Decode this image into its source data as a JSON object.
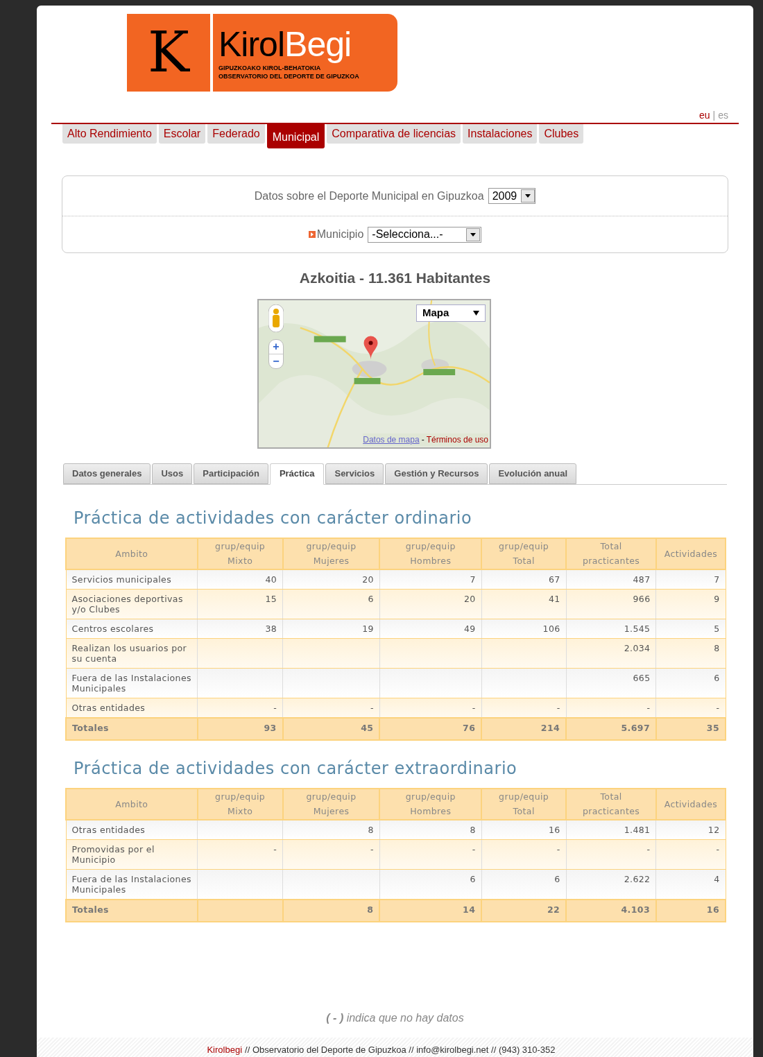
{
  "logo": {
    "letter": "K",
    "name_dark": "Kirol",
    "name_light": "Begi",
    "line_1": "GIPUZKOAKO KIROL-BEHATOKIA",
    "line_2": "OBSERVATORIO DEL DEPORTE DE GIPUZKOA"
  },
  "languages": [
    {
      "label": "eu",
      "selected": true
    },
    {
      "label": "es",
      "selected": false
    }
  ],
  "language_separator": "|",
  "nav_tabs": [
    {
      "label": "Alto Rendimiento",
      "selected": false
    },
    {
      "label": "Escolar",
      "selected": false
    },
    {
      "label": "Federado",
      "selected": false
    },
    {
      "label": "Municipal",
      "selected": true
    },
    {
      "label": "Comparativa de licencias",
      "selected": false
    },
    {
      "label": "Instalaciones",
      "selected": false
    },
    {
      "label": "Clubes",
      "selected": false
    }
  ],
  "filter": {
    "year_label": "Datos sobre el Deporte Municipal en Gipuzkoa",
    "year_value": "2009",
    "municipio_label": "Municipio",
    "municipio_value": "-Selecciona...-"
  },
  "heading": "Azkoitia - 11.361 Habitantes",
  "map": {
    "type_select": "Mapa",
    "zoom_in": "+",
    "zoom_out": "−",
    "data_link": "Datos de mapa",
    "separator": "-",
    "terms_link": "Términos de uso"
  },
  "sub_tabs": [
    {
      "label": "Datos generales",
      "selected": false
    },
    {
      "label": "Usos",
      "selected": false
    },
    {
      "label": "Participación",
      "selected": false
    },
    {
      "label": "Práctica",
      "selected": true
    },
    {
      "label": "Servicios",
      "selected": false
    },
    {
      "label": "Gestión y Recursos",
      "selected": false
    },
    {
      "label": "Evolución anual",
      "selected": false
    }
  ],
  "tables": [
    {
      "title": "Práctica de actividades con carácter ordinario",
      "columns": [
        "Ambito",
        "grup/equip\nMixto",
        "grup/equip\nMujeres",
        "grup/equip\nHombres",
        "grup/equip\nTotal",
        "Total\npracticantes",
        "Actividades"
      ],
      "rows": [
        {
          "cells": [
            "Servicios municipales",
            "40",
            "20",
            "7",
            "67",
            "487",
            "7"
          ]
        },
        {
          "cells": [
            "Asociaciones deportivas y/o Clubes",
            "15",
            "6",
            "20",
            "41",
            "966",
            "9"
          ]
        },
        {
          "cells": [
            "Centros escolares",
            "38",
            "19",
            "49",
            "106",
            "1.545",
            "5"
          ]
        },
        {
          "cells": [
            "Realizan los usuarios por su cuenta",
            "",
            "",
            "",
            "",
            "2.034",
            "8"
          ]
        },
        {
          "cells": [
            "Fuera de las Instalaciones Municipales",
            "",
            "",
            "",
            "",
            "665",
            "6"
          ]
        },
        {
          "cells": [
            "Otras entidades",
            "-",
            "-",
            "-",
            "-",
            "-",
            "-"
          ]
        }
      ],
      "totals": {
        "cells": [
          "Totales",
          "93",
          "45",
          "76",
          "214",
          "5.697",
          "35"
        ]
      }
    },
    {
      "title": "Práctica de actividades con carácter extraordinario",
      "columns": [
        "Ambito",
        "grup/equip\nMixto",
        "grup/equip\nMujeres",
        "grup/equip\nHombres",
        "grup/equip\nTotal",
        "Total\npracticantes",
        "Actividades"
      ],
      "rows": [
        {
          "cells": [
            "Otras entidades",
            "",
            "8",
            "8",
            "16",
            "1.481",
            "12"
          ]
        },
        {
          "cells": [
            "Promovidas por el Municipio",
            "-",
            "-",
            "-",
            "-",
            "-",
            "-"
          ]
        },
        {
          "cells": [
            "Fuera de las Instalaciones Municipales",
            "",
            "",
            "6",
            "6",
            "2.622",
            "4"
          ]
        }
      ],
      "totals": {
        "cells": [
          "Totales",
          "",
          "8",
          "14",
          "22",
          "4.103",
          "16"
        ]
      }
    }
  ],
  "note": "**( - )** indica que no hay datos",
  "footer": {
    "brand": "Kirolbegi",
    "text": "// Observatorio del Deporte de Gipuzkoa // info@kirolbegi.net // (943) 310-352"
  }
}
